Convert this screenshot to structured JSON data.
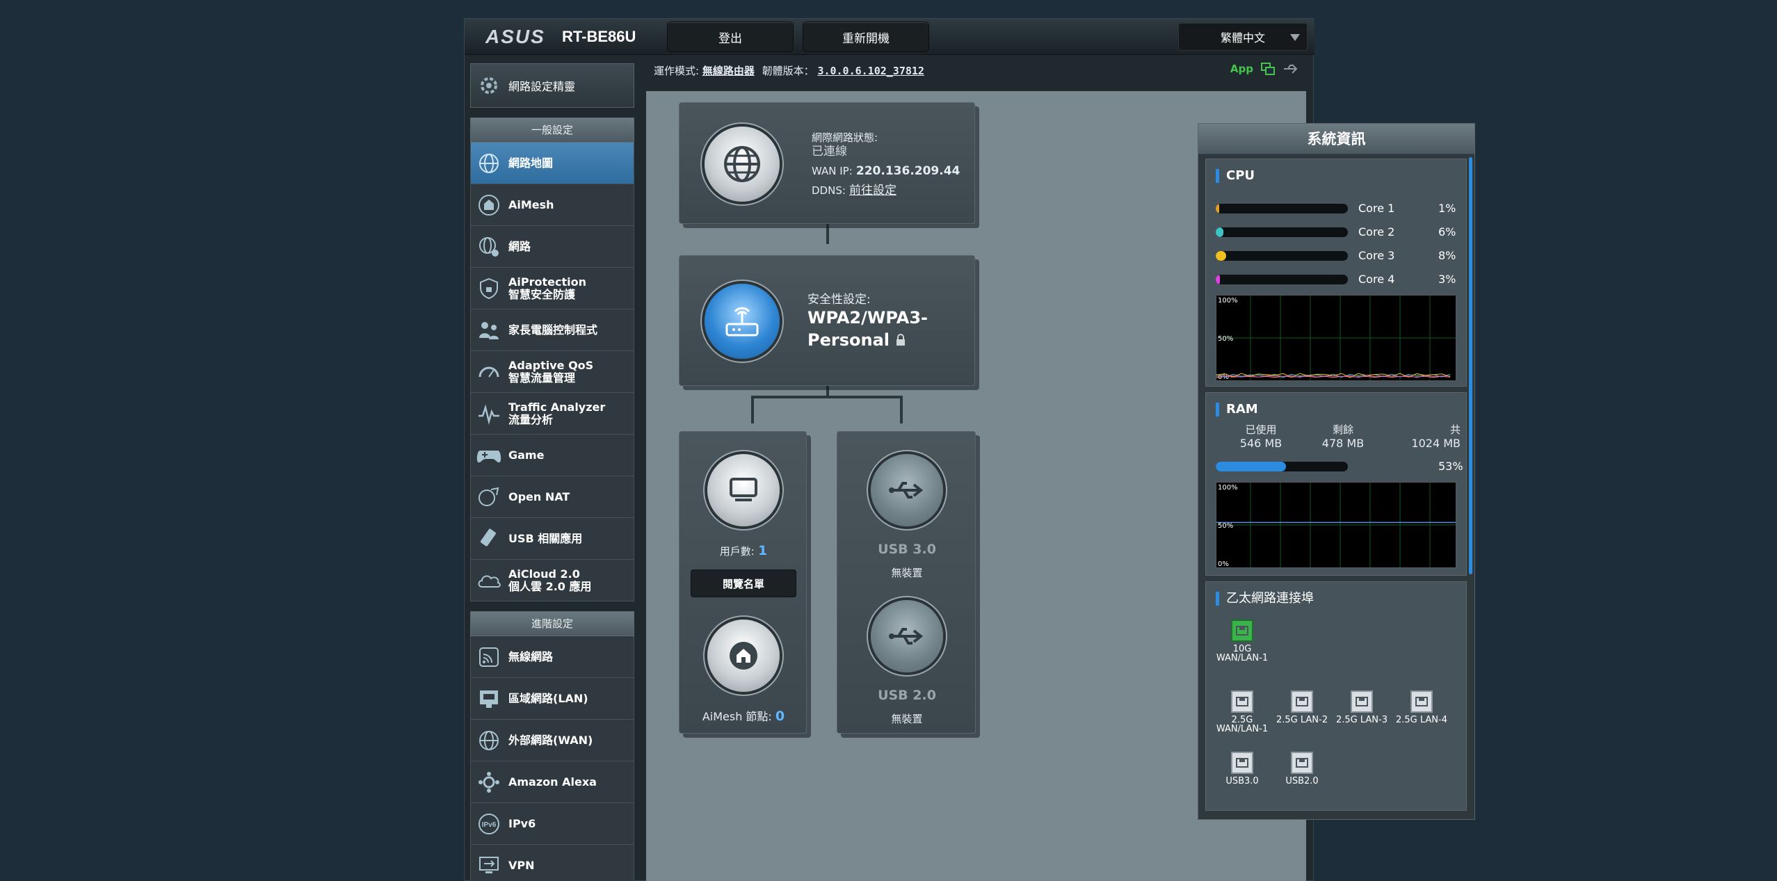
{
  "header": {
    "brand": "ASUS",
    "model": "RT-BE86U",
    "logout_label": "登出",
    "reboot_label": "重新開機",
    "language": "繁體中文"
  },
  "status_strip": {
    "mode_label": "運作模式:",
    "mode_value": "無線路由器",
    "firmware_label": "韌體版本：",
    "firmware_value": "3.0.0.6.102_37812",
    "app_label": "App"
  },
  "sidebar": {
    "quick_label": "網路設定精靈",
    "general_header": "一般設定",
    "general_items": [
      {
        "label": "網路地圖",
        "sub": ""
      },
      {
        "label": "AiMesh",
        "sub": ""
      },
      {
        "label": "網路",
        "sub": ""
      },
      {
        "label": "AiProtection",
        "sub": "智慧安全防護"
      },
      {
        "label": "家長電腦控制程式",
        "sub": ""
      },
      {
        "label": "Adaptive QoS",
        "sub": "智慧流量管理"
      },
      {
        "label": "Traffic Analyzer",
        "sub": "流量分析"
      },
      {
        "label": "Game",
        "sub": ""
      },
      {
        "label": "Open NAT",
        "sub": ""
      },
      {
        "label": "USB 相關應用",
        "sub": ""
      },
      {
        "label": "AiCloud 2.0",
        "sub": "個人雲 2.0 應用"
      }
    ],
    "advanced_header": "進階設定",
    "advanced_items": [
      {
        "label": "無線網路"
      },
      {
        "label": "區域網路(LAN)"
      },
      {
        "label": "外部網路(WAN)"
      },
      {
        "label": "Amazon Alexa"
      },
      {
        "label": "IPv6"
      },
      {
        "label": "VPN"
      }
    ]
  },
  "network_map": {
    "internet": {
      "status_label": "網際網路狀態:",
      "status_value": "已連線",
      "wan_ip_label": "WAN IP:",
      "wan_ip_value": "220.136.209.44",
      "ddns_label": "DDNS:",
      "ddns_value": "前往設定"
    },
    "security": {
      "label": "安全性設定:",
      "value_line1": "WPA2/WPA3-",
      "value_line2": "Personal"
    },
    "clients": {
      "label": "用戶數:",
      "count": "1",
      "view_list_label": "閱覽名單"
    },
    "aimesh": {
      "label": "AiMesh 節點:",
      "count": "0"
    },
    "usb3": {
      "label": "USB 3.0",
      "status": "無裝置"
    },
    "usb2": {
      "label": "USB 2.0",
      "status": "無裝置"
    }
  },
  "system_info": {
    "title": "系統資訊",
    "cpu": {
      "title": "CPU",
      "cores": [
        {
          "name": "Core 1",
          "percent": "1%",
          "value": 1,
          "color": "#e0a020"
        },
        {
          "name": "Core 2",
          "percent": "6%",
          "value": 6,
          "color": "#3cc4c4"
        },
        {
          "name": "Core 3",
          "percent": "8%",
          "value": 8,
          "color": "#f0c020"
        },
        {
          "name": "Core 4",
          "percent": "3%",
          "value": 3,
          "color": "#e040e0"
        }
      ],
      "graph_labels": [
        "100%",
        "50%",
        "0%"
      ]
    },
    "ram": {
      "title": "RAM",
      "used_label": "已使用",
      "used_value": "546 MB",
      "free_label": "剩餘",
      "free_value": "478 MB",
      "total_label": "共",
      "total_value": "1024 MB",
      "percent": "53%",
      "value": 53,
      "graph_labels": [
        "100%",
        "50%",
        "0%"
      ]
    },
    "ethernet": {
      "title": "乙太網路連接埠",
      "ports": [
        {
          "label": "10G WAN/LAN-1",
          "active": true
        },
        {
          "label": "2.5G WAN/LAN-1",
          "active": false
        },
        {
          "label": "2.5G LAN-2",
          "active": false
        },
        {
          "label": "2.5G LAN-3",
          "active": false
        },
        {
          "label": "2.5G LAN-4",
          "active": false
        },
        {
          "label": "USB3.0",
          "active": false
        },
        {
          "label": "USB2.0",
          "active": false
        }
      ]
    }
  },
  "colors": {
    "accent_blue": "#2c8ce0",
    "active_nav": "#3a7cb0",
    "app_green": "#45c44a",
    "count_blue": "#5fb8ff"
  }
}
